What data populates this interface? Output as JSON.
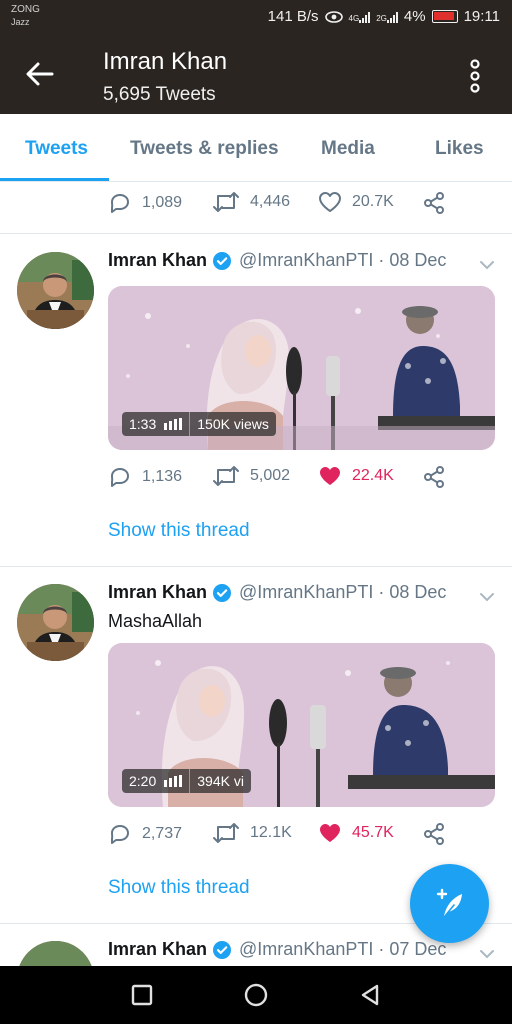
{
  "status_bar": {
    "carrier": "ZONG",
    "carrier_sub": "Jazz",
    "speed": "141 B/s",
    "net1": "4G",
    "net2": "2G",
    "battery": "4%",
    "time": "19:11"
  },
  "header": {
    "title": "Imran Khan",
    "subtitle": "5,695 Tweets"
  },
  "tabs": [
    "Tweets",
    "Tweets & replies",
    "Media",
    "Likes"
  ],
  "top_actions": {
    "replies": "1,089",
    "retweets": "4,446",
    "likes": "20.7K"
  },
  "tweets": [
    {
      "name": "Imran Khan",
      "handle": "@ImranKhanPTI · 08 Dec",
      "text": "",
      "video_duration": "1:33",
      "video_views": "150K views",
      "replies": "1,136",
      "retweets": "5,002",
      "likes": "22.4K",
      "liked": true,
      "thread_link": "Show this thread"
    },
    {
      "name": "Imran Khan",
      "handle": "@ImranKhanPTI · 08 Dec",
      "text": "MashaAllah",
      "video_duration": "2:20",
      "video_views": "394K vi",
      "replies": "2,737",
      "retweets": "12.1K",
      "likes": "45.7K",
      "liked": true,
      "thread_link": "Show this thread"
    },
    {
      "name": "Imran Khan",
      "handle": "@ImranKhanPTI · 07 Dec"
    }
  ],
  "colors": {
    "header_bg": "#2a2520",
    "accent": "#1da1f2",
    "like": "#e0245e",
    "muted": "#657786"
  },
  "icons": {
    "back": "arrow-left-icon",
    "more": "more-vertical-icon",
    "reply": "speech-bubble-icon",
    "retweet": "retweet-icon",
    "like": "heart-icon",
    "share": "share-icon",
    "verified": "verified-badge-icon",
    "compose": "feather-compose-icon"
  }
}
